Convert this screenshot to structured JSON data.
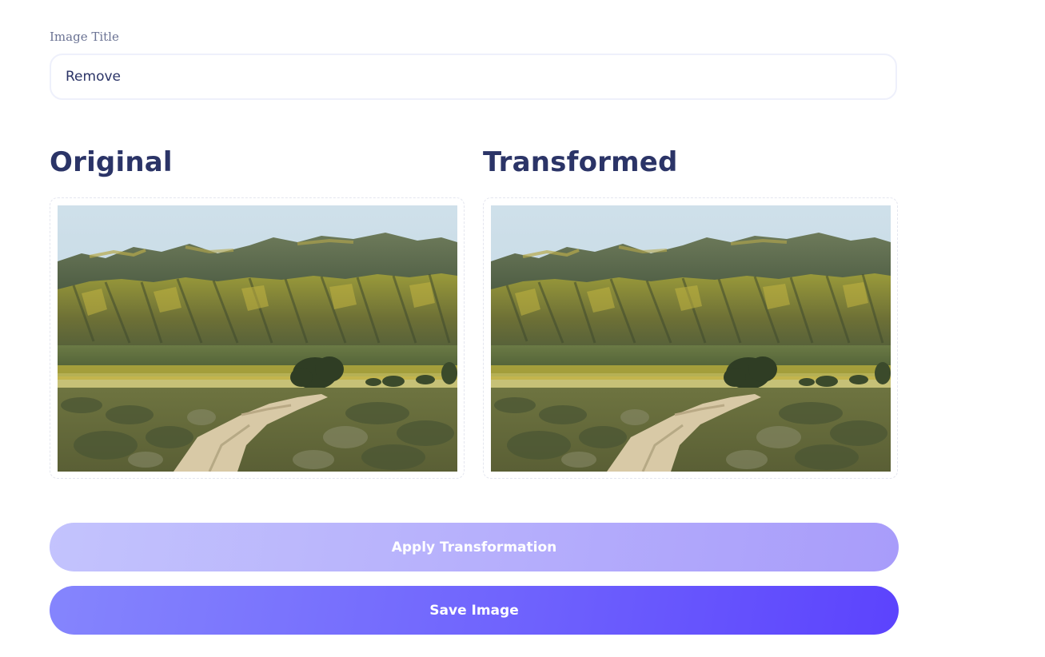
{
  "form": {
    "title_label": "Image Title",
    "title_value": "Remove"
  },
  "sections": {
    "original_heading": "Original",
    "transformed_heading": "Transformed"
  },
  "actions": {
    "apply_label": "Apply Transformation",
    "save_label": "Save Image"
  },
  "colors": {
    "heading_text": "#2b3467",
    "apply_button_gradient_start": "#c3c3fd",
    "apply_button_gradient_end": "#a89cfa",
    "save_button_gradient_start": "#8585fd",
    "save_button_gradient_end": "#5c43fd"
  }
}
